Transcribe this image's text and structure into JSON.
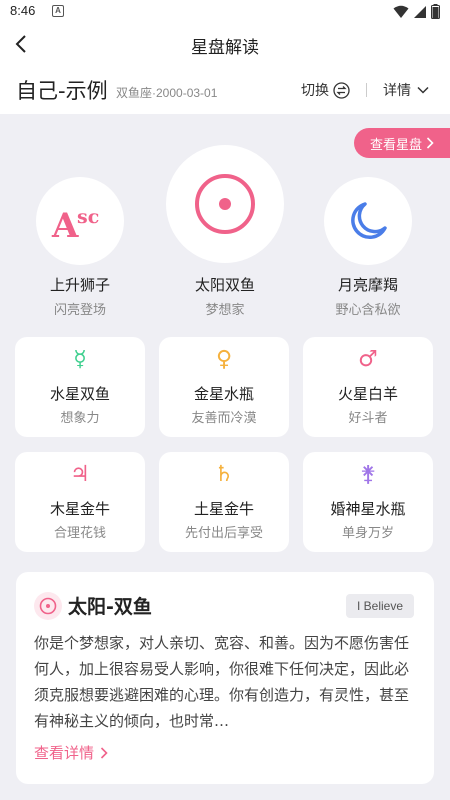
{
  "status": {
    "time": "8:46",
    "sim": "A"
  },
  "nav": {
    "title": "星盘解读"
  },
  "profile": {
    "name": "自己-示例",
    "sub": "双鱼座·2000-03-01",
    "switch_label": "切换",
    "detail_label": "详情"
  },
  "chart_button": "查看星盘",
  "big3": [
    {
      "glyph": "Asc",
      "title": "上升狮子",
      "sub": "闪亮登场"
    },
    {
      "glyph": "sun",
      "title": "太阳双鱼",
      "sub": "梦想家"
    },
    {
      "glyph": "moon",
      "title": "月亮摩羯",
      "sub": "野心含私欲"
    }
  ],
  "planets": [
    {
      "glyph": "☿",
      "color": "#3ecf8e",
      "title": "水星双鱼",
      "sub": "想象力"
    },
    {
      "glyph": "♀",
      "color": "#f5b13d",
      "title": "金星水瓶",
      "sub": "友善而冷漠"
    },
    {
      "glyph": "♂",
      "color": "#f0628a",
      "title": "火星白羊",
      "sub": "好斗者"
    },
    {
      "glyph": "♃",
      "color": "#f0628a",
      "title": "木星金牛",
      "sub": "合理花钱"
    },
    {
      "glyph": "♄",
      "color": "#f5b13d",
      "title": "土星金牛",
      "sub": "先付出后享受"
    },
    {
      "glyph": "⚵",
      "color": "#a076e8",
      "title": "婚神星水瓶",
      "sub": "单身万岁"
    }
  ],
  "reading": {
    "title": "太阳-双鱼",
    "tag": "I Believe",
    "body": "你是个梦想家，对人亲切、宽容、和善。因为不愿伤害任何人，加上很容易受人影响，你很难下任何决定，因此必须克服想要逃避困难的心理。你有创造力，有灵性，甚至有神秘主义的倾向，也时常…",
    "more_label": "查看详情"
  },
  "colors": {
    "accent": "#f0628a",
    "moon": "#4a7de8",
    "background": "#efeff4"
  }
}
